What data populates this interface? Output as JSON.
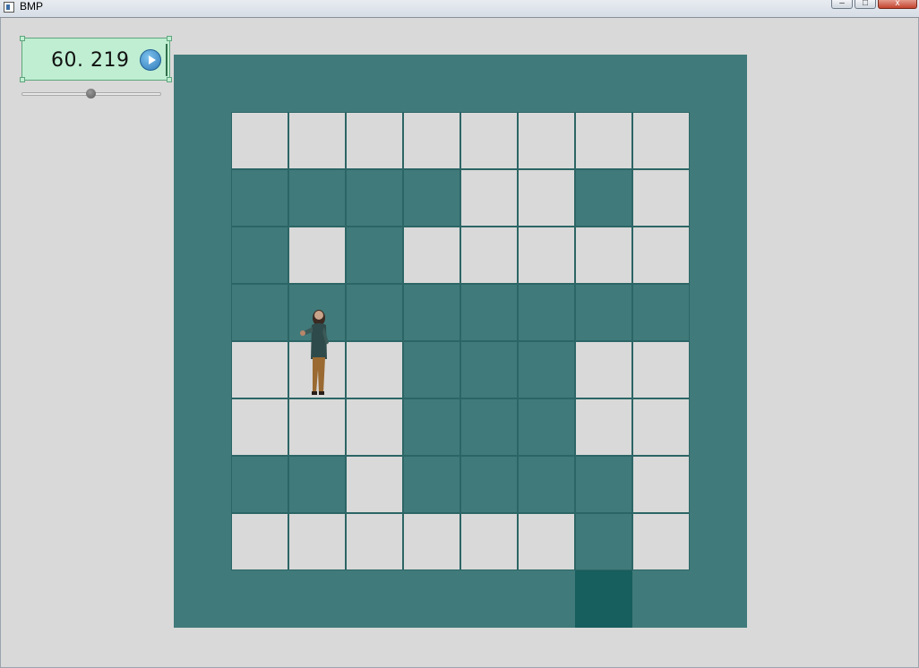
{
  "window": {
    "title": "BMP",
    "minimize_label": "–",
    "maximize_label": "□",
    "close_label": "x"
  },
  "timer": {
    "value": "60. 219"
  },
  "slider": {
    "value_fraction": 0.5
  },
  "colors": {
    "background": "#d9d9d9",
    "wall": "#417a7a",
    "floor": "#d9d9d9",
    "goal": "#175e5e",
    "timer_bg": "#bfeed2"
  },
  "maze": {
    "rows": 10,
    "cols": 10,
    "legend": {
      "W": "wall",
      "E": "empty",
      "G": "goal"
    },
    "grid": [
      "WWWWWWWWWW",
      "WEEEEEEEEW",
      "WWWWWEEWEW",
      "WWEWEEEEEW",
      "WWWWWWWWWW",
      "WEEEWWWEEW",
      "WEEEWWWEEW",
      "WWWEWWWWEW",
      "WEEEEEEWEW",
      "WWWWWWWGWW"
    ],
    "player": {
      "row": 5,
      "col": 2,
      "icon": "character-sprite"
    }
  }
}
